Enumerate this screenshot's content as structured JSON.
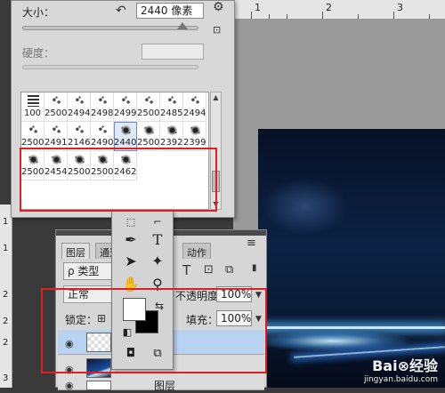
{
  "brush_panel": {
    "size_label": "大小：",
    "size_value": "2440 像素",
    "hardness_label": "硬度：",
    "presets": [
      {
        "value": "100",
        "icon": "hard-round-brush"
      },
      {
        "value": "2500",
        "icon": "scatter-brush"
      },
      {
        "value": "2494",
        "icon": "scatter-brush"
      },
      {
        "value": "2498",
        "icon": "scatter-brush"
      },
      {
        "value": "2499",
        "icon": "scatter-brush"
      },
      {
        "value": "2500",
        "icon": "scatter-brush"
      },
      {
        "value": "2485",
        "icon": "scatter-brush"
      },
      {
        "value": "2494",
        "icon": "scatter-brush"
      },
      {
        "value": "2500",
        "icon": "scatter-brush"
      },
      {
        "value": "2491",
        "icon": "scatter-brush"
      },
      {
        "value": "2146",
        "icon": "scatter-brush"
      },
      {
        "value": "2490",
        "icon": "scatter-brush"
      },
      {
        "value": "2440",
        "icon": "splatter-brush",
        "selected": true
      },
      {
        "value": "2500",
        "icon": "splatter-brush"
      },
      {
        "value": "2392",
        "icon": "splatter-brush"
      },
      {
        "value": "2399",
        "icon": "splatter-brush"
      },
      {
        "value": "2500",
        "icon": "splatter-brush"
      },
      {
        "value": "2454",
        "icon": "splatter-brush"
      },
      {
        "value": "2500",
        "icon": "splatter-brush"
      },
      {
        "value": "2500",
        "icon": "splatter-brush"
      },
      {
        "value": "2462",
        "icon": "splatter-brush"
      }
    ]
  },
  "ruler": {
    "top": [
      "1",
      "2",
      "3"
    ],
    "left": [
      "1",
      "1",
      "2",
      "2",
      "2",
      "3"
    ]
  },
  "layers_panel": {
    "tabs": [
      "图层",
      "通道",
      "动作"
    ],
    "filter_label": "ρ 类型",
    "blend_mode": "正常",
    "opacity_label": "不透明度：",
    "opacity_value": "100%",
    "lock_label": "锁定：",
    "fill_label": "填充：",
    "fill_value": "100%",
    "layers": [
      {
        "name": "",
        "selected": true
      },
      {
        "name": "",
        "selected": false
      },
      {
        "name": "图层",
        "selected": false
      }
    ]
  },
  "tools": {
    "fg_color": "#ffffff",
    "bg_color": "#000000"
  },
  "watermark": {
    "brand": "Bai⊗经验",
    "site": "jingyan.baidu.com"
  },
  "colors": {
    "highlight": "#e02020",
    "selection": "#b8d2f2"
  }
}
